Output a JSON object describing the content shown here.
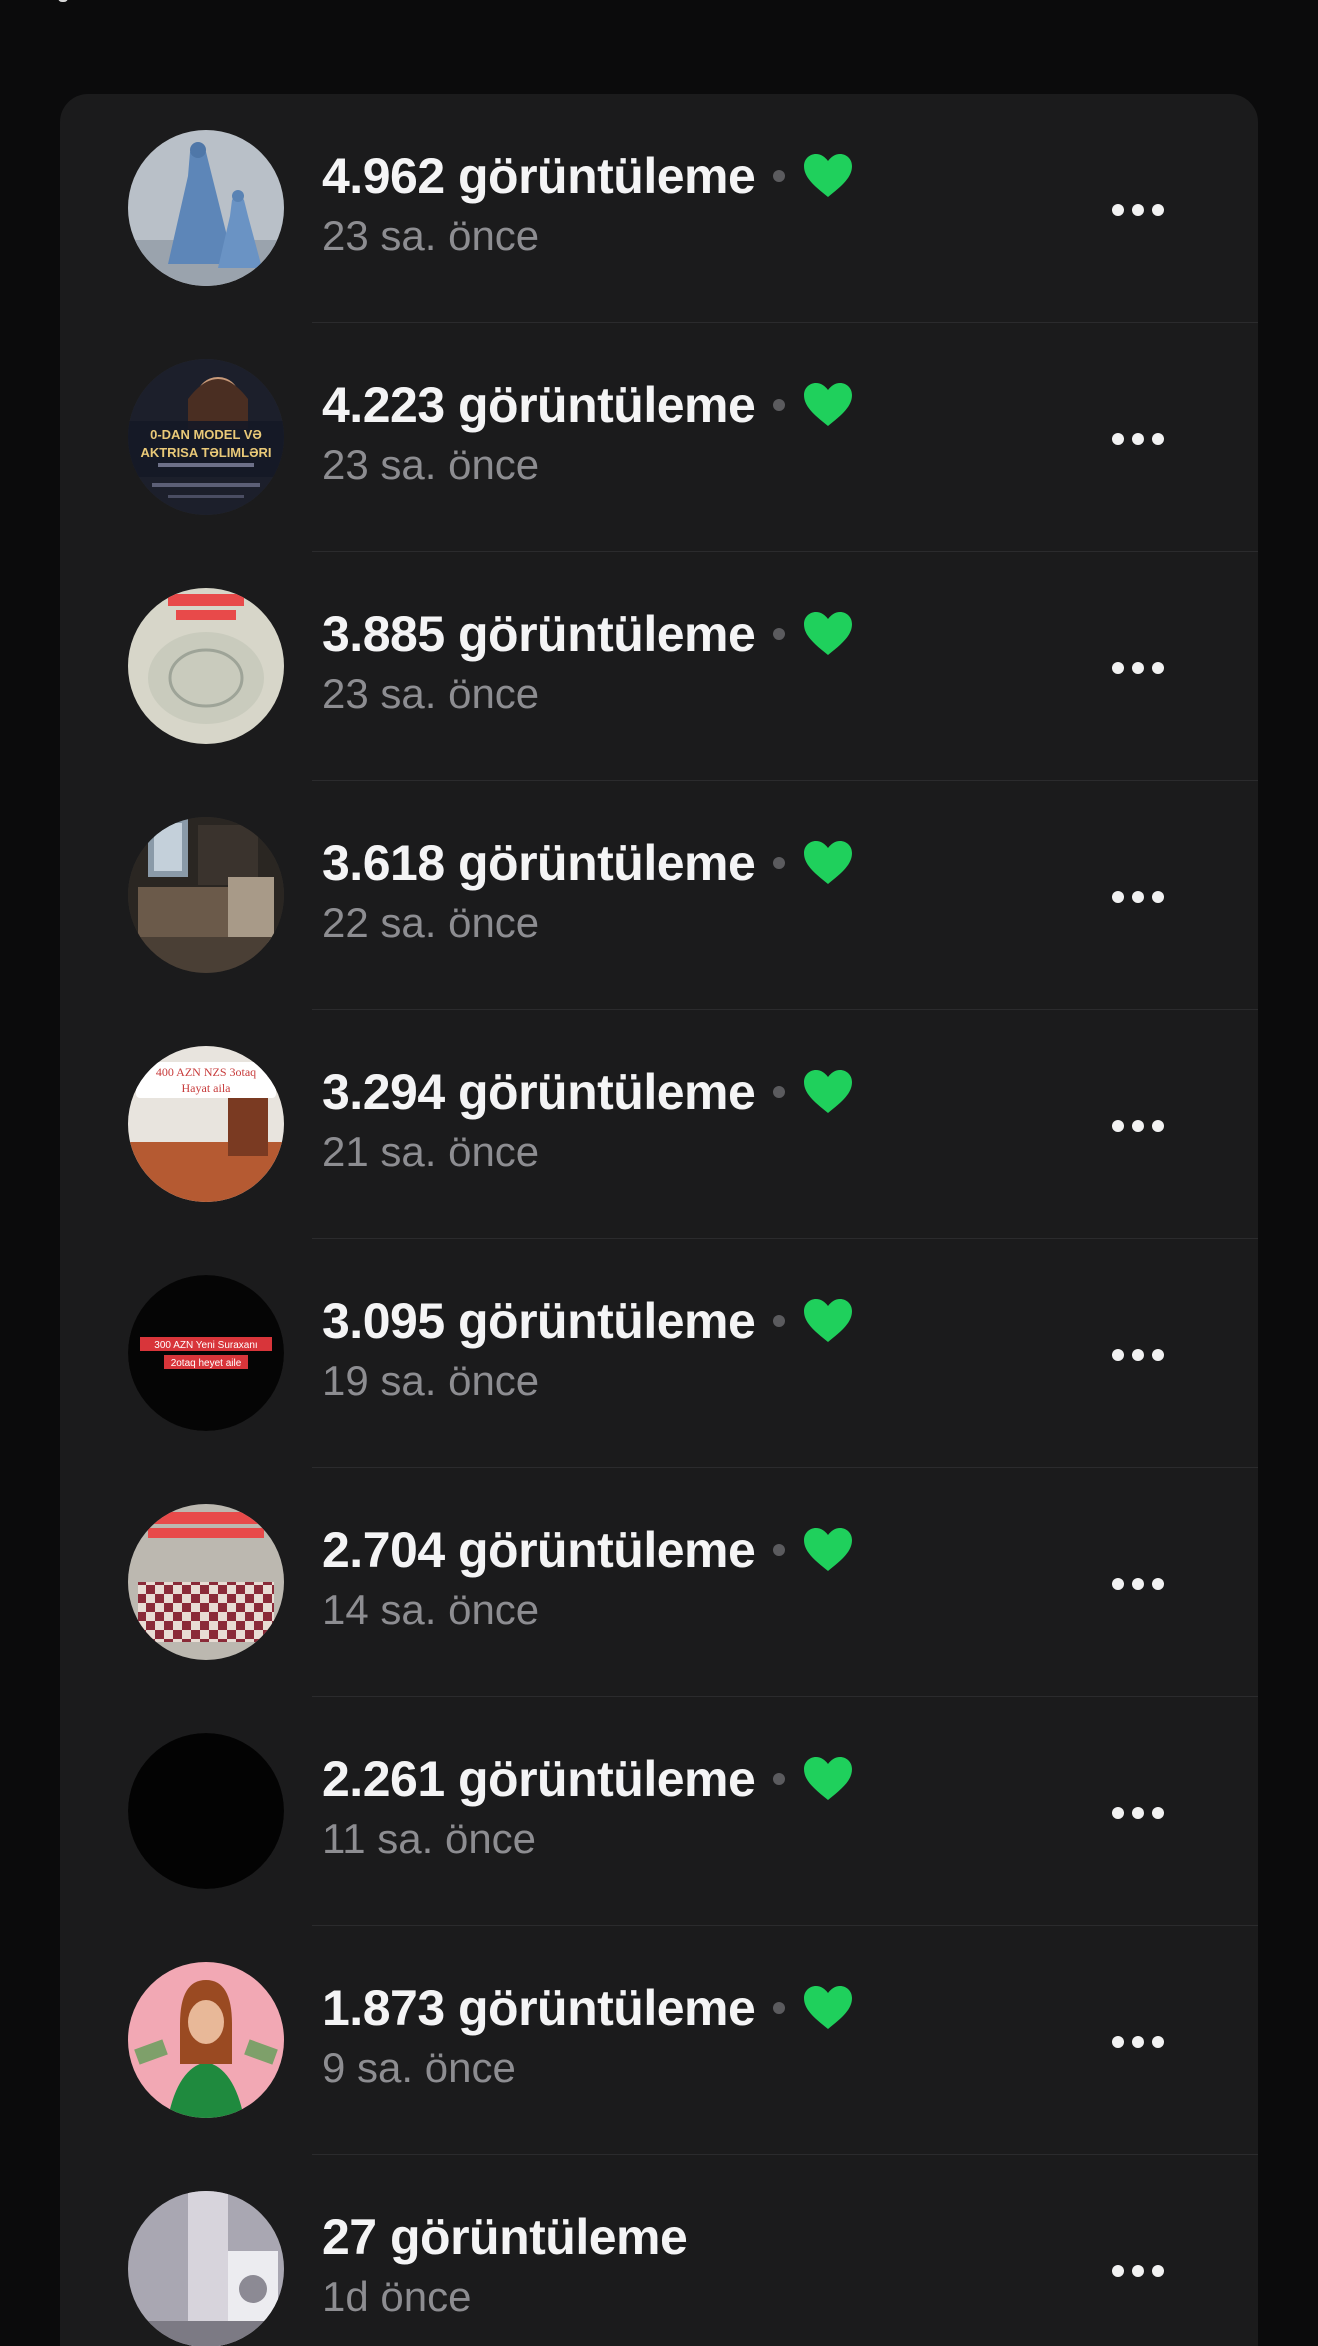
{
  "list": {
    "accent_color": "#1fd05c",
    "items": [
      {
        "views": "4.962 görüntüleme",
        "time": "23 sa. önce",
        "liked": true,
        "thumb": "dress"
      },
      {
        "views": "4.223 görüntüleme",
        "time": "23 sa. önce",
        "liked": true,
        "thumb": "model",
        "thumb_text": [
          "0-DAN MODEL VƏ",
          "AKTRISA TƏLIMLƏRI"
        ]
      },
      {
        "views": "3.885 görüntüleme",
        "time": "23 sa. önce",
        "liked": true,
        "thumb": "carpet"
      },
      {
        "views": "3.618 görüntüleme",
        "time": "22 sa. önce",
        "liked": true,
        "thumb": "room"
      },
      {
        "views": "3.294 görüntüleme",
        "time": "21 sa. önce",
        "liked": true,
        "thumb": "apartment",
        "thumb_text": [
          "400 AZN NZS 3otaq",
          "Hayat aila"
        ]
      },
      {
        "views": "3.095 görüntüleme",
        "time": "19 sa. önce",
        "liked": true,
        "thumb": "black-text",
        "thumb_text": [
          "300 AZN Yeni Suraxanı",
          "2otaq heyet aile"
        ]
      },
      {
        "views": "2.704 görüntüleme",
        "time": "14 sa. önce",
        "liked": true,
        "thumb": "bed"
      },
      {
        "views": "2.261 görüntüleme",
        "time": "11 sa. önce",
        "liked": true,
        "thumb": "black"
      },
      {
        "views": "1.873 görüntüleme",
        "time": "9 sa. önce",
        "liked": true,
        "thumb": "woman-money"
      },
      {
        "views": "27 görüntüleme",
        "time": "1d önce",
        "liked": false,
        "thumb": "laundry"
      }
    ]
  }
}
